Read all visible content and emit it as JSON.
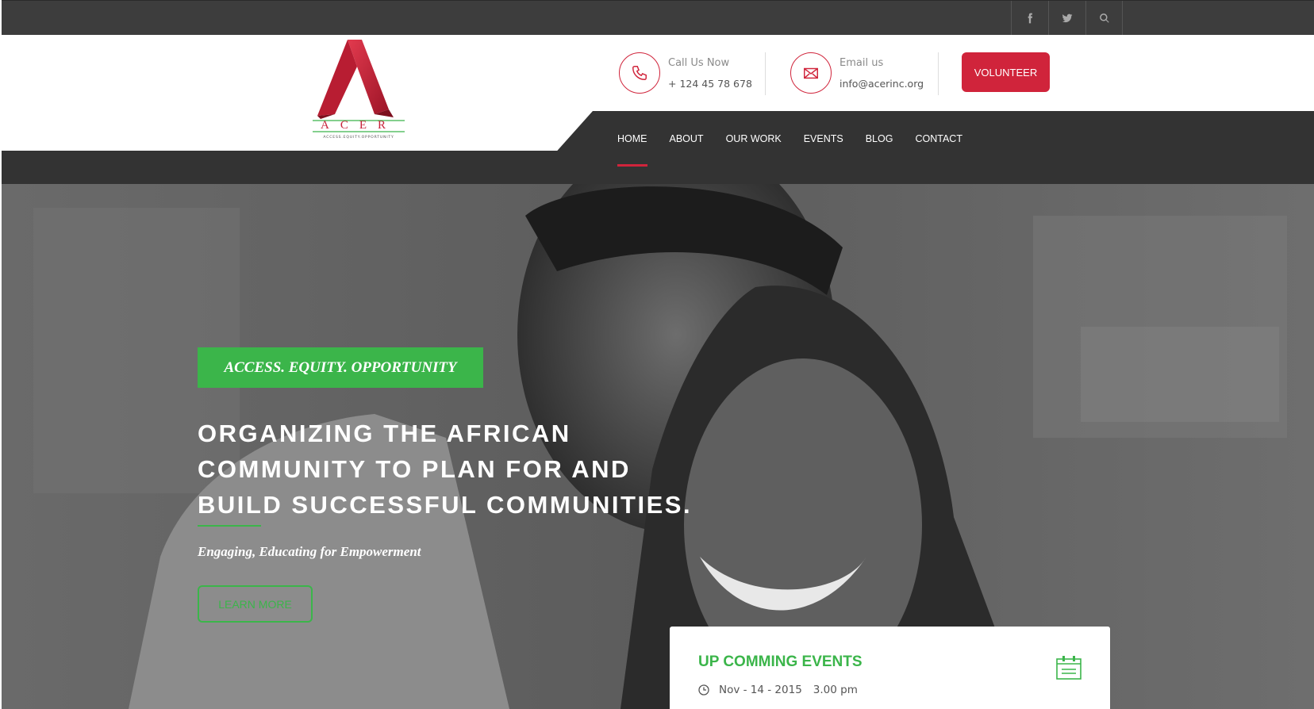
{
  "topbar": {
    "social": [
      {
        "icon": "facebook-icon",
        "glyph": "f"
      },
      {
        "icon": "twitter-icon",
        "glyph": "t"
      },
      {
        "icon": "search-icon",
        "glyph": "s"
      }
    ]
  },
  "logo": {
    "letters": "ACER",
    "tagline": "ACCESS.EQUITY.OPPORTUNITY",
    "colors": {
      "red": "#c8223a",
      "green": "#3bb54a"
    }
  },
  "contact": {
    "phone_label": "Call Us Now",
    "phone_value": "+ 124 45 78 678",
    "email_label": "Email us",
    "email_value": "info@acerinc.org"
  },
  "volunteer_label": "VOLUNTEER",
  "nav": {
    "items": [
      "HOME",
      "ABOUT",
      "OUR WORK",
      "EVENTS",
      "BLOG",
      "CONTACT"
    ],
    "active": "HOME"
  },
  "hero": {
    "tagline": "ACCESS. EQUITY. OPPORTUNITY",
    "headline_lines": [
      "ORGANIZING THE AFRICAN",
      "COMMUNITY TO PLAN FOR AND",
      "BUILD SUCCESSFUL COMMUNITIES."
    ],
    "subline": "Engaging, Educating for Empowerment",
    "cta": "LEARN MORE"
  },
  "events": {
    "title": "UP COMMING EVENTS",
    "date": "Nov - 14 - 2015",
    "time": "3.00 pm"
  },
  "colors": {
    "accent_red": "#d0243b",
    "accent_green": "#3bb54a",
    "dark_bar": "#333333",
    "top_bar": "#3d3d3d"
  }
}
